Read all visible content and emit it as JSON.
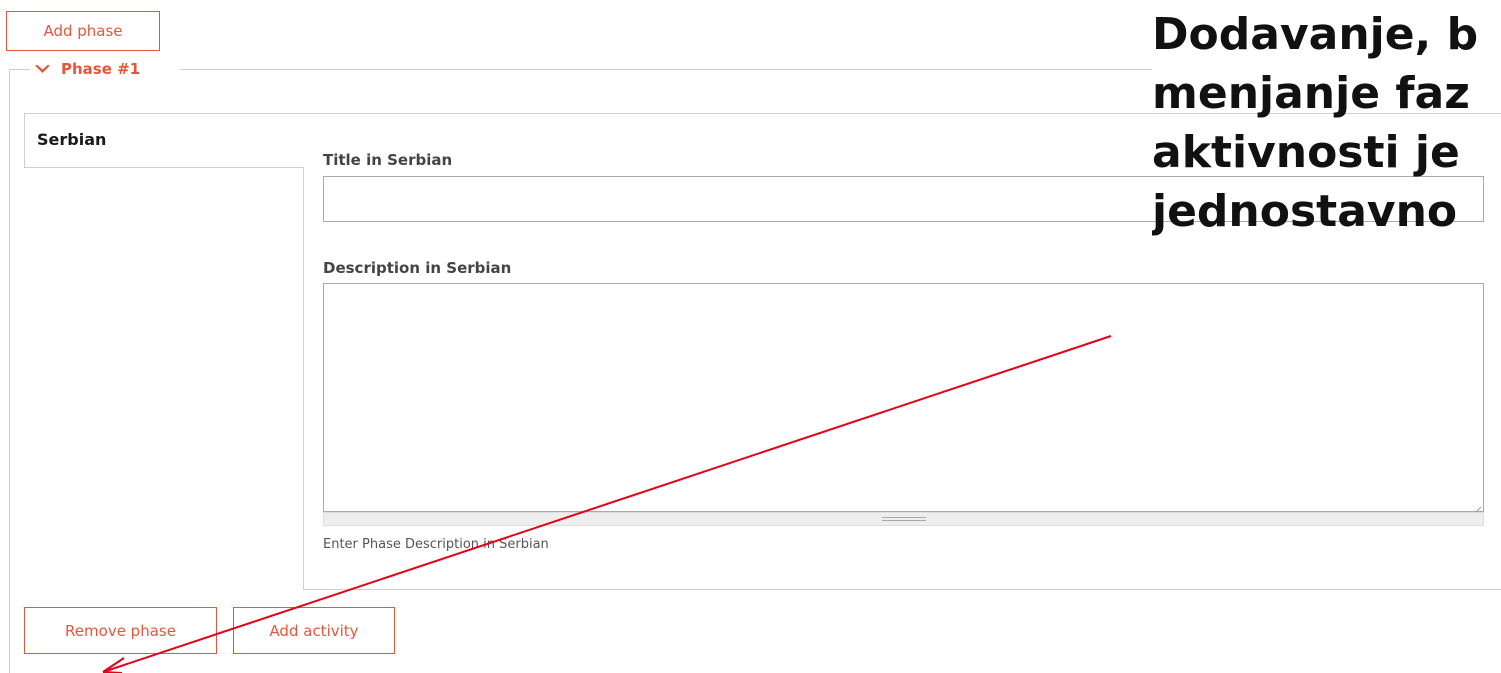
{
  "toolbar": {
    "add_phase_label": "Add phase"
  },
  "phase": {
    "legend": "Phase #1",
    "tab": {
      "label": "Serbian"
    },
    "title_field": {
      "label": "Title in Serbian",
      "value": "",
      "placeholder": ""
    },
    "description_field": {
      "label": "Description in Serbian",
      "value": "",
      "placeholder": "",
      "help_text": "Enter Phase Description in Serbian"
    },
    "actions": {
      "remove_label": "Remove phase",
      "add_activity_label": "Add activity"
    }
  },
  "annotation": {
    "lines": [
      "Dodavanje, b",
      "menjanje faz",
      "aktivnosti je",
      "jednostavno"
    ],
    "arrow_color": "#e0001b"
  },
  "colors": {
    "accent": "#e4573d",
    "border": "#cfcfcf"
  },
  "icons": {
    "legend_icon": "chevron-down-icon"
  }
}
